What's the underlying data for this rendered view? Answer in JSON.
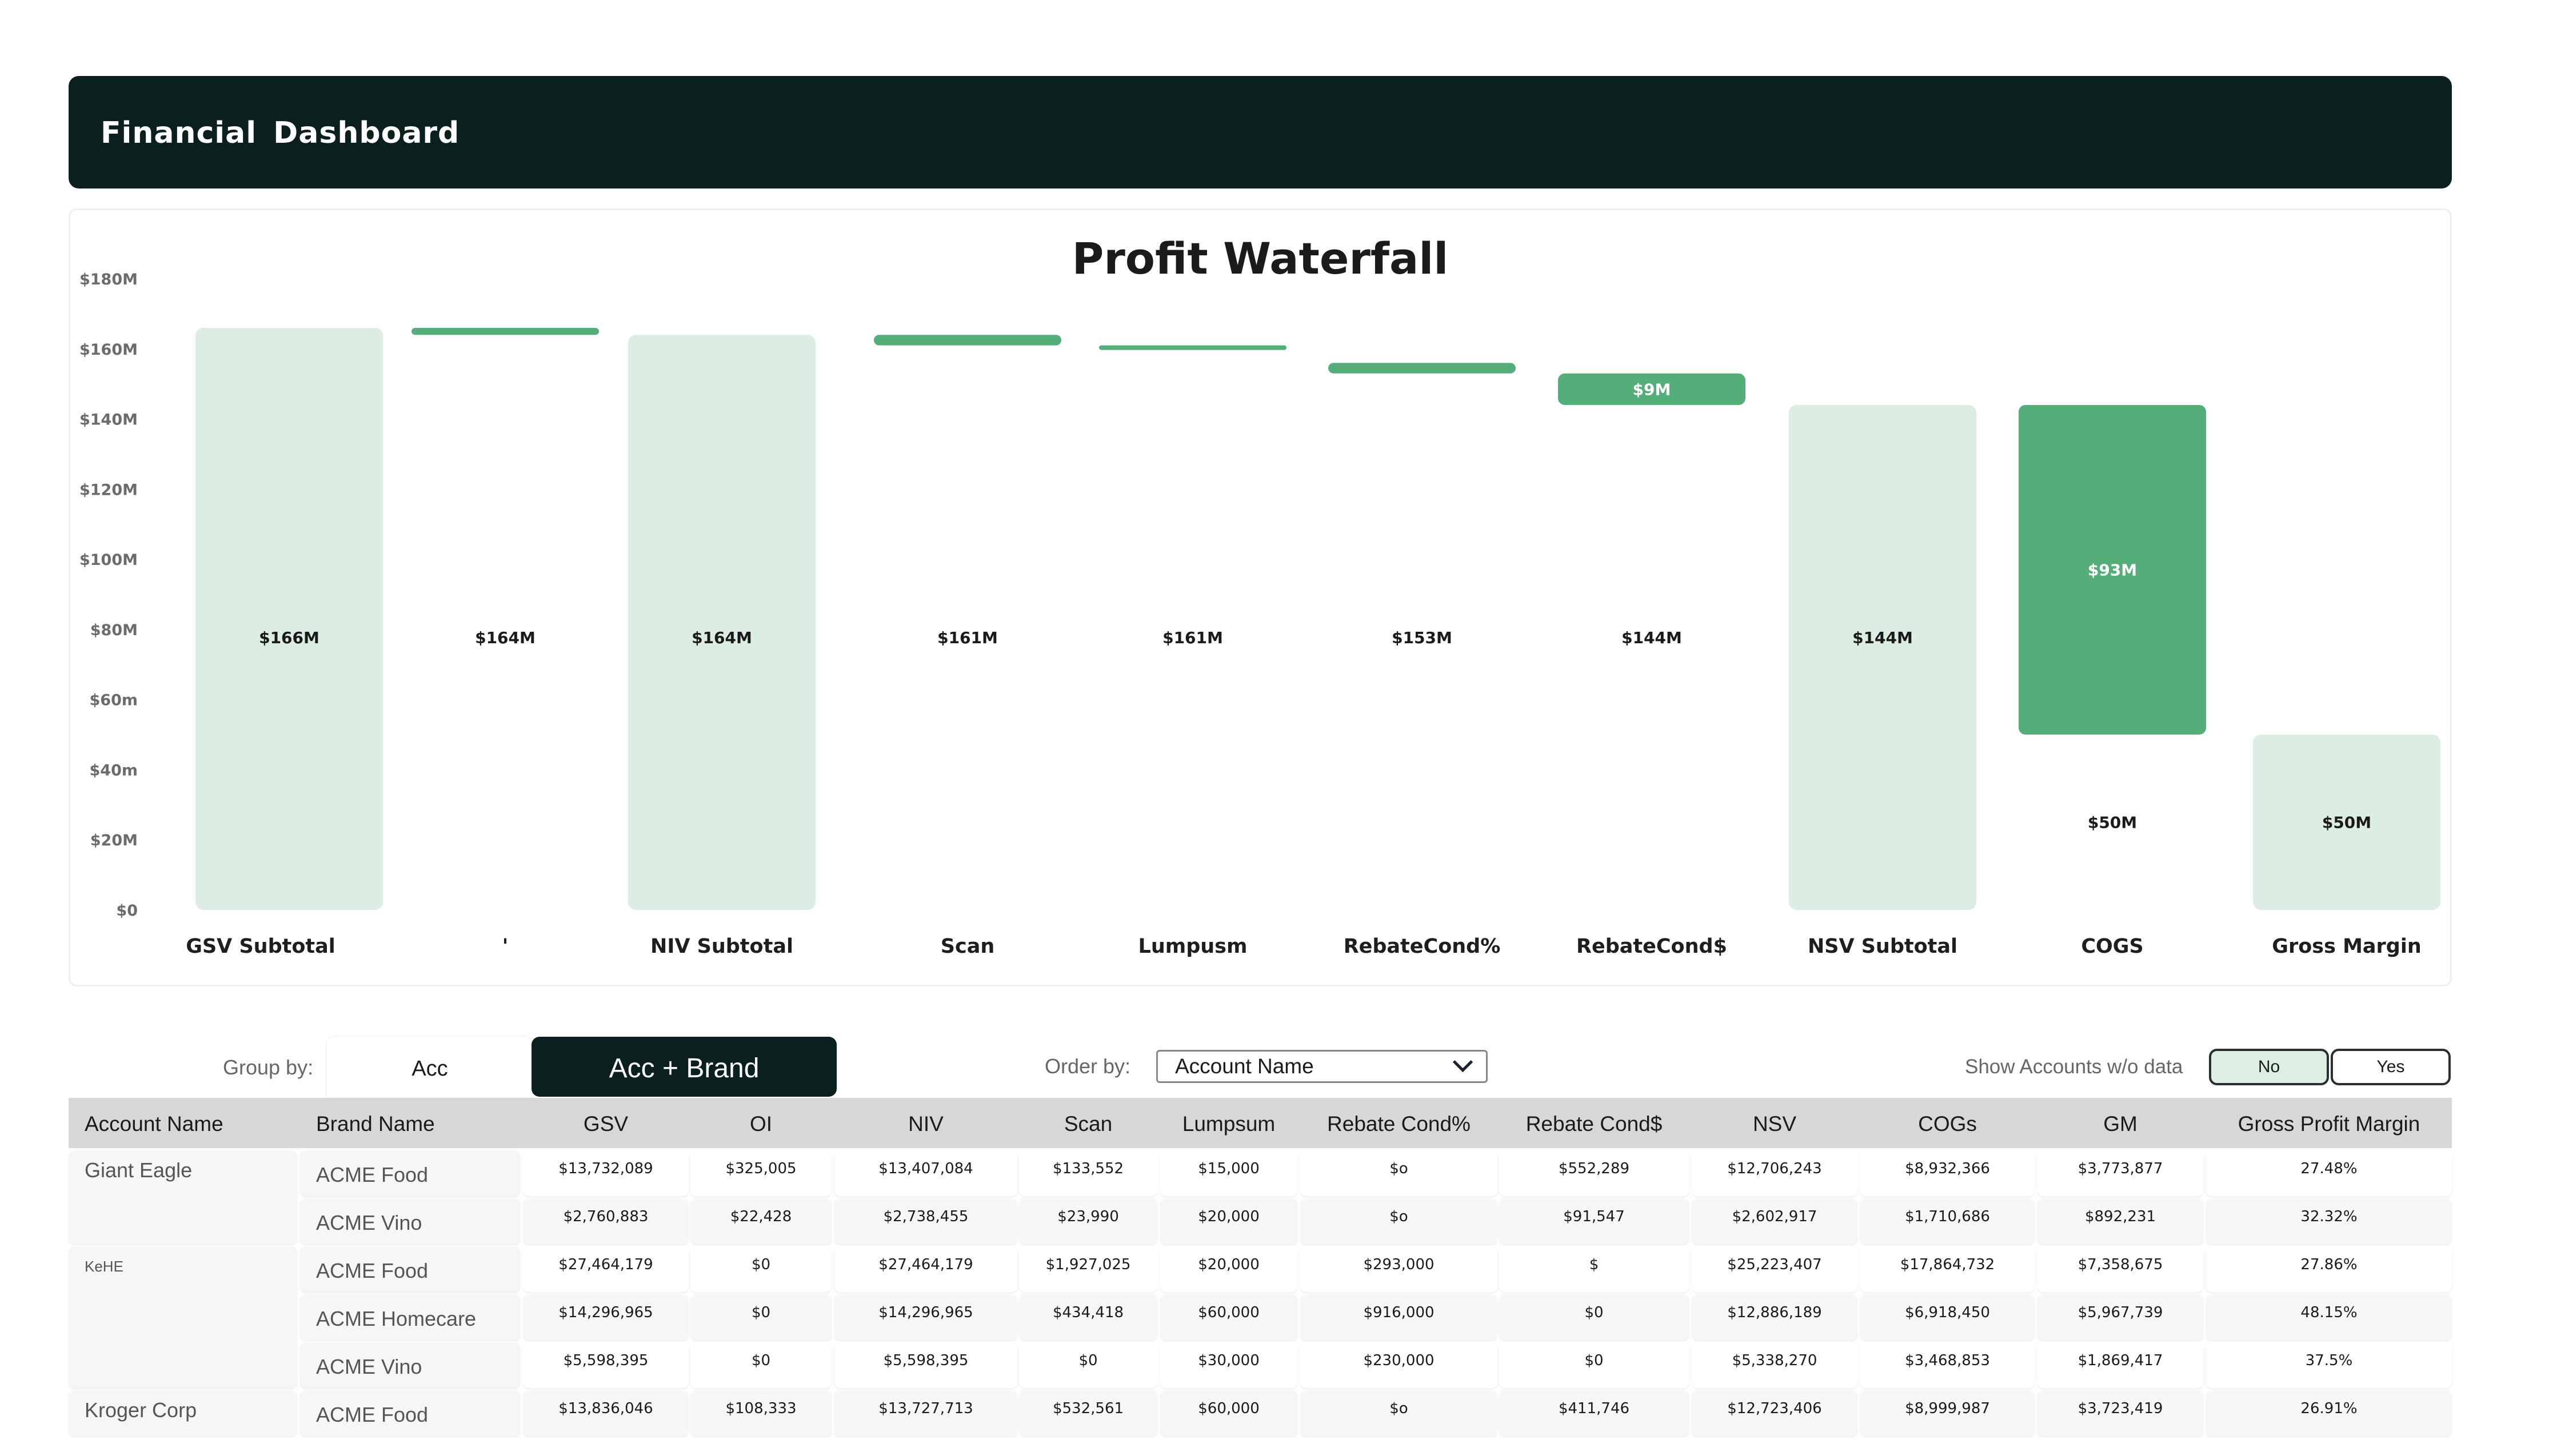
{
  "header": {
    "title": "Financial  Dashboard"
  },
  "chart_data": {
    "type": "bar",
    "subtype": "waterfall",
    "title": "Profit Waterfall",
    "xlabel": "",
    "ylabel": "",
    "ylim": [
      0,
      180
    ],
    "y_unit": "$M",
    "y_ticks": [
      {
        "value": 0,
        "label": "$0"
      },
      {
        "value": 20,
        "label": "$20M"
      },
      {
        "value": 40,
        "label": "$40m"
      },
      {
        "value": 60,
        "label": "$60m"
      },
      {
        "value": 80,
        "label": "$80M"
      },
      {
        "value": 100,
        "label": "$100M"
      },
      {
        "value": 120,
        "label": "$120M"
      },
      {
        "value": 140,
        "label": "$140M"
      },
      {
        "value": 160,
        "label": "$160M"
      },
      {
        "value": 180,
        "label": "$180M"
      }
    ],
    "grid": false,
    "legend": "none",
    "categories": [
      "GSV Subtotal",
      "'",
      "NIV Subtotal",
      "Scan",
      "Lumpusm",
      "RebateCond%",
      "RebateCond$",
      "NSV Subtotal",
      "COGS",
      "Gross Margin"
    ],
    "bars": [
      {
        "category": "GSV Subtotal",
        "kind": "total",
        "start": 0,
        "end": 166,
        "label": "$166M",
        "label_position": "inside"
      },
      {
        "category": "'",
        "kind": "delta",
        "start": 166,
        "end": 164,
        "running_label": "$164M"
      },
      {
        "category": "NIV Subtotal",
        "kind": "total",
        "start": 0,
        "end": 164,
        "label": "$164M",
        "label_position": "inside"
      },
      {
        "category": "Scan",
        "kind": "delta",
        "start": 164,
        "end": 161,
        "running_label": "$161M"
      },
      {
        "category": "Lumpusm",
        "kind": "delta",
        "start": 161,
        "end": 160.5,
        "running_label": "$161M"
      },
      {
        "category": "RebateCond%",
        "kind": "delta",
        "start": 156,
        "end": 153,
        "running_label": "$153M"
      },
      {
        "category": "RebateCond$",
        "kind": "delta",
        "start": 153,
        "end": 144,
        "label": "$9M",
        "running_label": "$144M"
      },
      {
        "category": "NSV Subtotal",
        "kind": "total",
        "start": 0,
        "end": 144,
        "label": "$144M",
        "label_position": "inside"
      },
      {
        "category": "COGS",
        "kind": "delta",
        "start": 144,
        "end": 50,
        "label": "$93M",
        "running_label": "$50M"
      },
      {
        "category": "Gross Margin",
        "kind": "total",
        "start": 0,
        "end": 50,
        "label": "$50M",
        "label_position": "inside"
      }
    ],
    "colors": {
      "total": "#dcede3",
      "delta": "#55ad79",
      "delta_label": "#ffffff",
      "label": "#1a1a1a"
    }
  },
  "controls": {
    "group_by_label": "Group by:",
    "group_by_options": [
      "Acc",
      "Acc + Brand"
    ],
    "group_by_selected": "Acc + Brand",
    "order_by_label": "Order by:",
    "order_by_value": "Account Name",
    "show_accounts_label": "Show Accounts w/o data",
    "show_accounts_options": [
      "No",
      "Yes"
    ],
    "show_accounts_selected": "No"
  },
  "table": {
    "columns": [
      "Account Name",
      "Brand Name",
      "GSV",
      "OI",
      "NIV",
      "Scan",
      "Lumpsum",
      "Rebate Cond%",
      "Rebate Cond$",
      "NSV",
      "COGs",
      "GM",
      "Gross Profit Margin"
    ],
    "accounts": [
      {
        "name": "Giant Eagle",
        "rows": [
          [
            "ACME Food",
            "$13,732,089",
            "$325,005",
            "$13,407,084",
            "$133,552",
            "$15,000",
            "$o",
            "$552,289",
            "$12,706,243",
            "$8,932,366",
            "$3,773,877",
            "27.48%"
          ],
          [
            "ACME Vino",
            "$2,760,883",
            "$22,428",
            "$2,738,455",
            "$23,990",
            "$20,000",
            "$o",
            "$91,547",
            "$2,602,917",
            "$1,710,686",
            "$892,231",
            "32.32%"
          ]
        ]
      },
      {
        "name": "KeHE",
        "rows": [
          [
            "ACME Food",
            "$27,464,179",
            "$0",
            "$27,464,179",
            "$1,927,025",
            "$20,000",
            "$293,000",
            "$",
            "$25,223,407",
            "$17,864,732",
            "$7,358,675",
            "27.86%"
          ],
          [
            "ACME Homecare",
            "$14,296,965",
            "$0",
            "$14,296,965",
            "$434,418",
            "$60,000",
            "$916,000",
            "$0",
            "$12,886,189",
            "$6,918,450",
            "$5,967,739",
            "48.15%"
          ],
          [
            "ACME Vino",
            "$5,598,395",
            "$0",
            "$5,598,395",
            "$0",
            "$30,000",
            "$230,000",
            "$0",
            "$5,338,270",
            "$3,468,853",
            "$1,869,417",
            "37.5%"
          ]
        ]
      },
      {
        "name": "Kroger Corp",
        "rows": [
          [
            "ACME Food",
            "$13,836,046",
            "$108,333",
            "$13,727,713",
            "$532,561",
            "$60,000",
            "$o",
            "$411,746",
            "$12,723,406",
            "$8,999,987",
            "$3,723,419",
            "26.91%"
          ]
        ]
      }
    ]
  }
}
